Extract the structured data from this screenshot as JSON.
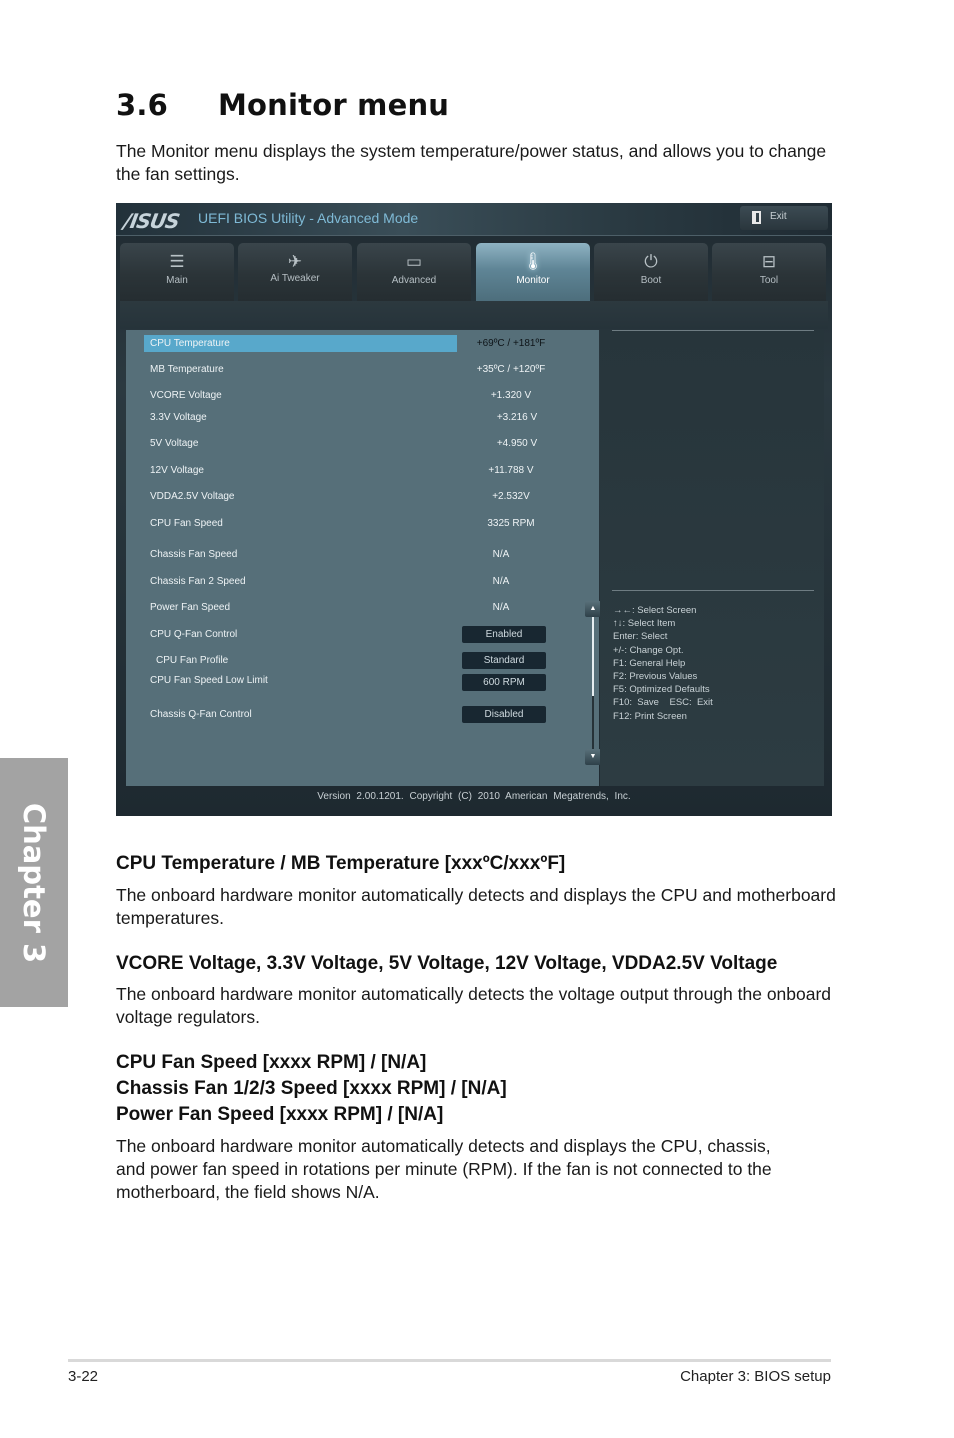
{
  "section": {
    "number": "3.6",
    "title": "Monitor menu",
    "intro": "The Monitor menu displays the system temperature/power status, and allows you to change the fan settings."
  },
  "chapter_tab": "Chapter 3",
  "bios": {
    "logo": "/ISUS",
    "title": "UEFI BIOS Utility - Advanced Mode",
    "exit_label": "Exit",
    "tabs": [
      {
        "label": "Main",
        "icon": "list-icon"
      },
      {
        "label": "Ai  Tweaker",
        "icon": "rocket-icon"
      },
      {
        "label": "Advanced",
        "icon": "info-panel-icon"
      },
      {
        "label": "Monitor",
        "icon": "thermometer-icon",
        "active": true
      },
      {
        "label": "Boot",
        "icon": "power-icon"
      },
      {
        "label": "Tool",
        "icon": "toolbox-icon"
      }
    ],
    "items": [
      {
        "label": "CPU Temperature",
        "value": "+69ºC / +181ºF",
        "selected": true
      },
      {
        "label": "MB Temperature",
        "value": "+35ºC / +120ºF"
      },
      {
        "label": "VCORE Voltage",
        "value": "+1.320 V"
      },
      {
        "label": "3.3V Voltage",
        "value": "+3.216 V"
      },
      {
        "label": "5V Voltage",
        "value": "+4.950 V"
      },
      {
        "label": "12V Voltage",
        "value": "+11.788 V"
      },
      {
        "label": "VDDA2.5V Voltage",
        "value": "+2.532V"
      },
      {
        "label": "CPU Fan Speed",
        "value": "3325 RPM"
      },
      {
        "label": "Chassis Fan Speed",
        "value": "N/A"
      },
      {
        "label": "Chassis Fan 2 Speed",
        "value": "N/A"
      },
      {
        "label": "Power Fan Speed",
        "value": "N/A"
      }
    ],
    "options": [
      {
        "label": "CPU Q-Fan Control",
        "value": "Enabled"
      },
      {
        "label": "CPU Fan Profile",
        "value": "Standard"
      },
      {
        "label": "CPU Fan Speed Low Limit",
        "value": "600 RPM"
      },
      {
        "label": "Chassis Q-Fan Control",
        "value": "Disabled"
      }
    ],
    "scroll_position": 0.6,
    "help_keys": [
      "→←:  Select Screen",
      "↑↓:  Select Item",
      "Enter:  Select",
      "+/-:  Change Opt.",
      "F1:  General Help",
      "F2:  Previous Values",
      "F5:  Optimized Defaults",
      "F10:  Save    ESC:  Exit",
      "F12: Print Screen"
    ],
    "footer": "Version 2.00.1201. Copyright (C) 2010 American Megatrends, Inc."
  },
  "descriptions": [
    {
      "titles": [
        "CPU Temperature / MB Temperature [xxxºC/xxxºF]"
      ],
      "text": "The onboard hardware monitor automatically detects and displays the CPU and motherboard temperatures."
    },
    {
      "titles": [
        "VCORE Voltage, 3.3V Voltage, 5V Voltage, 12V Voltage, VDDA2.5V Voltage"
      ],
      "text": "The onboard hardware monitor automatically detects the voltage output through the onboard voltage regulators."
    },
    {
      "titles": [
        "CPU Fan Speed [xxxx RPM] / [N/A]",
        "Chassis Fan 1/2/3 Speed [xxxx RPM] / [N/A]",
        "Power Fan Speed [xxxx RPM] / [N/A]"
      ],
      "text": "The onboard hardware monitor automatically detects and displays the CPU, chassis, and power fan speed in rotations per minute (RPM). If the fan is not connected to the motherboard, the field shows N/A."
    }
  ],
  "footer": {
    "page": "3-22",
    "chapter": "Chapter 3: BIOS setup"
  }
}
